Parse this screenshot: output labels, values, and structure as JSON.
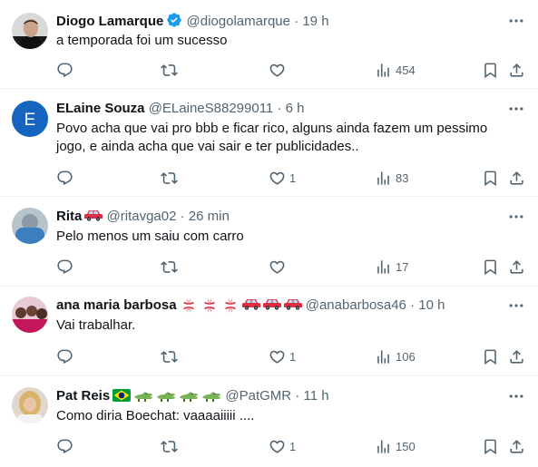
{
  "colors": {
    "accent": "#1d9bf0",
    "muted": "#536471",
    "text": "#0f1419",
    "divider": "#eff3f4"
  },
  "tweets": [
    {
      "name": "Diogo Lamarque",
      "handle": "@diogolamarque",
      "time": "19 h",
      "separator": "·",
      "verified": true,
      "text": "a temporada foi um sucesso",
      "replies": "",
      "retweets": "",
      "likes": "",
      "views": "454",
      "avatar": "photo-man-black-shirt"
    },
    {
      "name": "ELaine Souza",
      "handle": "@ELaineS88299011",
      "time": "6 h",
      "separator": "·",
      "text": "Povo acha que vai pro bbb e ficar rico, alguns ainda fazem um pessimo jogo, e ainda acha que vai sair e ter publicidades..",
      "replies": "",
      "retweets": "",
      "likes": "1",
      "views": "83",
      "avatar_letter": "E",
      "avatar_color": "#1565c0"
    },
    {
      "name": "Rita",
      "name_emoji": "red-car-emoji",
      "handle": "@ritavga02",
      "time": "26 min",
      "separator": "·",
      "text": "Pelo menos um saiu com carro",
      "replies": "",
      "retweets": "",
      "likes": "",
      "views": "17",
      "avatar": "photo-person-blue"
    },
    {
      "name": "ana maria barbosa",
      "name_emoji": "anger-symbols-and-red-cars",
      "handle": "@anabarbosa46",
      "time": "10 h",
      "separator": "·",
      "text": "Vai trabalhar.",
      "replies": "",
      "retweets": "",
      "likes": "1",
      "views": "106",
      "avatar": "photo-group-pink"
    },
    {
      "name": "Pat Reis",
      "name_emoji": "brazil-flag-and-crocodiles",
      "handle": "@PatGMR",
      "time": "11 h",
      "separator": "·",
      "text": "Como diria Boechat: vaaaaiiiii ....",
      "replies": "",
      "retweets": "",
      "likes": "1",
      "views": "150",
      "avatar": "photo-woman-blonde"
    }
  ]
}
